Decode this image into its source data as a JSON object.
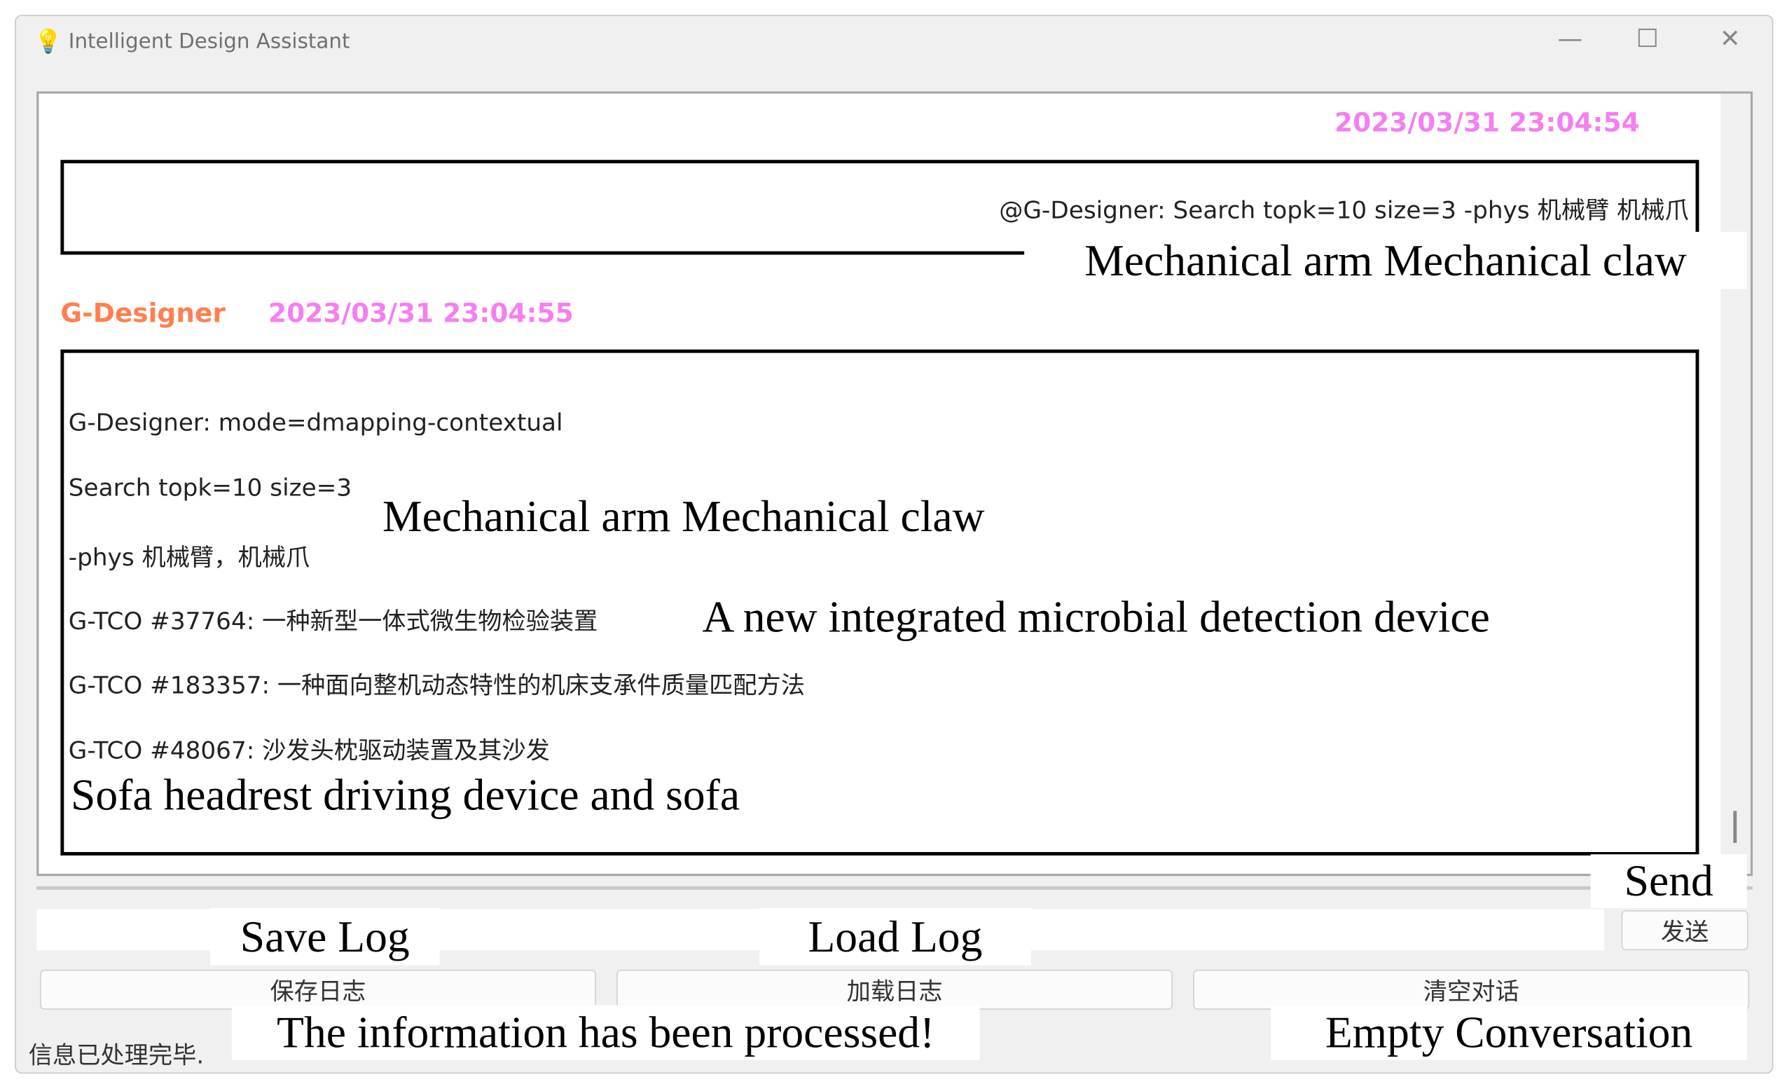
{
  "window": {
    "title": "Intelligent Design Assistant",
    "controls": {
      "minimize": "—",
      "maximize": "☐",
      "close": "✕"
    }
  },
  "chat": {
    "user_message": {
      "timestamp": "2023/03/31 23:04:54",
      "text": "@G-Designer: Search topk=10 size=3 -phys 机械臂 机械爪",
      "translation": "Mechanical arm Mechanical claw"
    },
    "bot_message": {
      "sender": "G-Designer",
      "timestamp": "2023/03/31 23:04:55",
      "lines": [
        "G-Designer: mode=dmapping-contextual",
        "Search topk=10 size=3",
        "-phys 机械臂，机械爪",
        "G-TCO #37764: 一种新型一体式微生物检验装置",
        "G-TCO #183357: 一种面向整机动态特性的机床支承件质量匹配方法",
        "G-TCO #48067: 沙发头枕驱动装置及其沙发"
      ],
      "translations": {
        "query": "Mechanical arm Mechanical claw",
        "item1": "A new integrated microbial detection device",
        "item3": "Sofa headrest driving device and sofa"
      }
    }
  },
  "input": {
    "value": "",
    "send_label": "发送",
    "send_translation": "Send"
  },
  "buttons": {
    "save_log": "保存日志",
    "save_log_translation": "Save Log",
    "load_log": "加载日志",
    "load_log_translation": "Load Log",
    "clear": "清空对话",
    "clear_translation": "Empty Conversation"
  },
  "status": {
    "text": "信息已处理完毕.",
    "translation": "The information has been processed!"
  },
  "colors": {
    "timestamp": "#f57ef0",
    "sender": "#ff7f50"
  }
}
